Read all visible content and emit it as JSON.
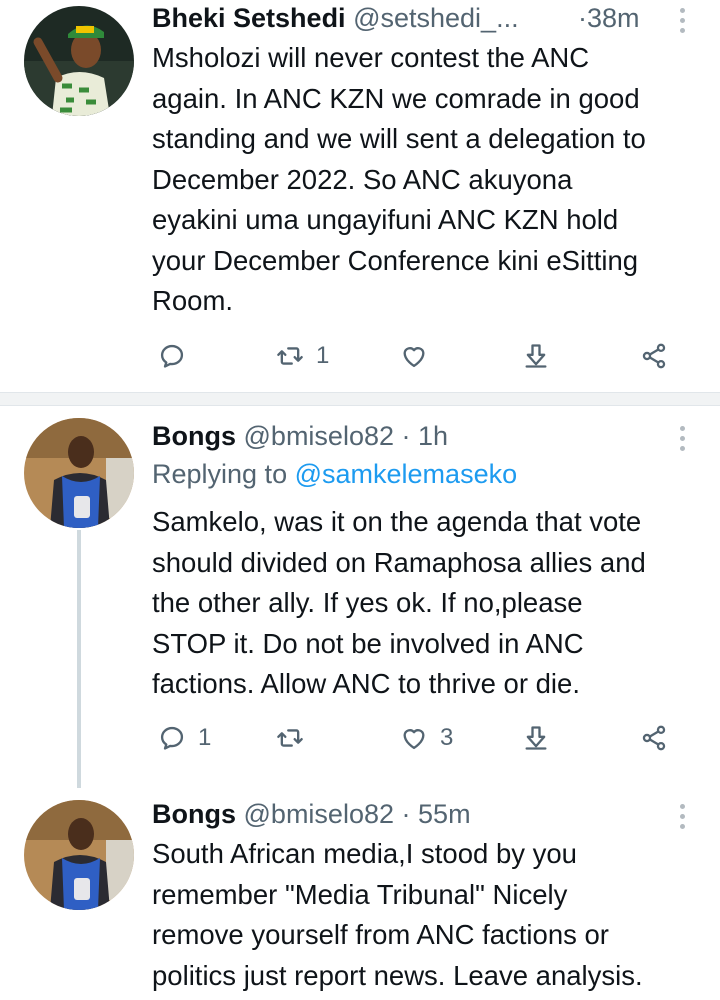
{
  "tweets": [
    {
      "name": "Bheki Setshedi",
      "handle": "@setshedi_...",
      "separator": "·",
      "time": "38m",
      "replying_label": "",
      "replying_handle": "",
      "body": [
        "Msholozi will never contest the ANC",
        "again. In ANC KZN we comrade in good",
        "standing and we will sent a delegation to",
        "December 2022. So ANC akuyona",
        "eyakini uma ungayifuni ANC KZN hold",
        "your December Conference kini eSitting",
        "Room."
      ],
      "stats": {
        "replies": "",
        "retweets": "1",
        "likes": ""
      },
      "avatar": "user-photo-green-cap"
    },
    {
      "name": "Bongs",
      "handle": "@bmiselo82",
      "separator": "·",
      "time": "1h",
      "replying_label": "Replying to",
      "replying_handle": "@samkelemaseko",
      "body": [
        "Samkelo, was it on the agenda that vote",
        "should divided on Ramaphosa allies and",
        "the other ally. If yes ok. If no,please",
        "STOP it. Do not be involved in ANC",
        "factions. Allow ANC to thrive or die."
      ],
      "stats": {
        "replies": "1",
        "retweets": "",
        "likes": "3"
      },
      "avatar": "user-photo-blue-apron"
    },
    {
      "name": "Bongs",
      "handle": "@bmiselo82",
      "separator": "·",
      "time": "55m",
      "replying_label": "",
      "replying_handle": "",
      "body": [
        "South African media,I stood by you",
        "remember \"Media Tribunal\" Nicely",
        "remove yourself from ANC factions or",
        "politics just report news. Leave analysis."
      ],
      "avatar": "user-photo-blue-apron"
    }
  ],
  "icons": {
    "reply": "reply-icon",
    "retweet": "retweet-icon",
    "like": "heart-icon",
    "share": "share-icon",
    "download": "download-icon",
    "more": "more-icon"
  },
  "colors": {
    "link": "#1d9bf0",
    "muted": "#536471",
    "text": "#0f1419"
  }
}
